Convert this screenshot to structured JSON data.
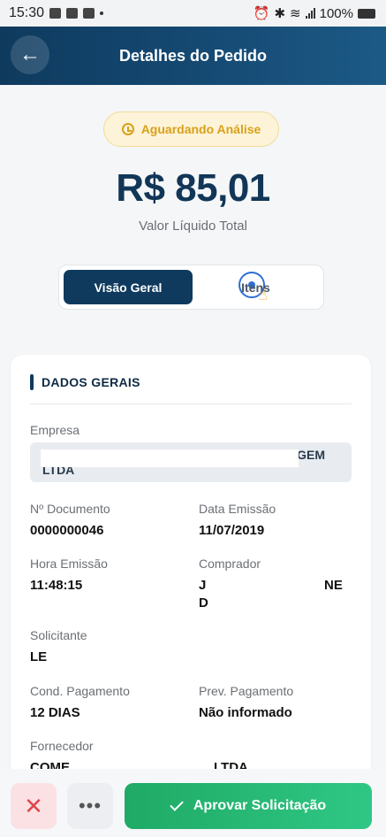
{
  "status_bar": {
    "time": "15:30",
    "battery": "100%"
  },
  "header": {
    "title": "Detalhes do Pedido",
    "back_icon": "arrow-left-icon"
  },
  "order": {
    "status": "Aguardando Análise",
    "amount": "R$ 85,01",
    "amount_label": "Valor Líquido Total"
  },
  "tabs": [
    {
      "label": "Visão Geral",
      "active": true
    },
    {
      "label": "Itens",
      "active": false
    }
  ],
  "details": {
    "section_title": "DADOS GERAIS",
    "empresa": {
      "label": "Empresa",
      "value_line1": "GEM",
      "value_line2": "LTDA"
    },
    "documento": {
      "label": "Nº Documento",
      "value": "0000000046"
    },
    "data_emissao": {
      "label": "Data Emissão",
      "value": "11/07/2019"
    },
    "hora_emissao": {
      "label": "Hora Emissão",
      "value": "11:48:15"
    },
    "comprador": {
      "label": "Comprador",
      "value_a": "J",
      "value_b": "NE",
      "value_c": "D"
    },
    "solicitante": {
      "label": "Solicitante",
      "value": "LE"
    },
    "cond_pagamento": {
      "label": "Cond. Pagamento",
      "value": "12 DIAS"
    },
    "prev_pagamento": {
      "label": "Prev. Pagamento",
      "value": "Não informado"
    },
    "fornecedor": {
      "label": "Fornecedor",
      "value_a": "COME",
      "value_b": "LTDA"
    }
  },
  "actions": {
    "reject": "✕",
    "more": "•••",
    "approve": "Aprovar Solicitação"
  },
  "colors": {
    "primary": "#0f3a5e",
    "warning": "#d9a11a",
    "success": "#22b06e",
    "danger": "#e0464e"
  }
}
